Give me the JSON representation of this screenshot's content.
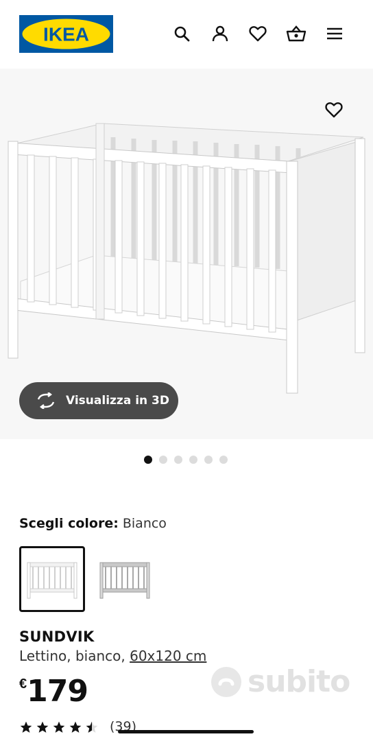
{
  "header": {
    "logo_text": "IKEA",
    "brand_colors": {
      "blue": "#0058a3",
      "yellow": "#ffdb00"
    },
    "icons": [
      "search-icon",
      "account-icon",
      "heart-icon",
      "cart-icon",
      "menu-icon"
    ]
  },
  "gallery": {
    "view3d_label": "Visualizza in 3D",
    "dots_total": 6,
    "active_dot": 0
  },
  "color": {
    "label": "Scegli colore:",
    "value": "Bianco",
    "options": [
      "Bianco",
      "Grigio"
    ]
  },
  "product": {
    "name": "SUNDVIK",
    "desc_prefix": "Lettino, bianco, ",
    "desc_size": "60x120 cm",
    "currency": "€",
    "price": "179",
    "rating": 4.5,
    "reviews": "(39)"
  },
  "watermark": {
    "text": "subito"
  }
}
